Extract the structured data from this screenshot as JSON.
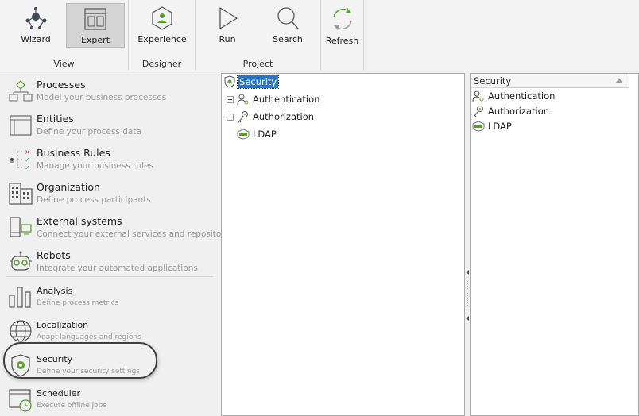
{
  "ribbon": {
    "groups": [
      {
        "label": "View",
        "buttons": [
          {
            "label": "Wizard",
            "icon": "wizard-icon"
          },
          {
            "label": "Expert",
            "icon": "expert-icon",
            "active": true
          }
        ]
      },
      {
        "label": "Designer",
        "buttons": [
          {
            "label": "Experience",
            "icon": "experience-icon"
          }
        ]
      },
      {
        "label": "Project",
        "buttons": [
          {
            "label": "Run",
            "icon": "run-icon"
          },
          {
            "label": "Search",
            "icon": "search-icon"
          }
        ]
      },
      {
        "label": "",
        "buttons": [
          {
            "label": "Refresh",
            "icon": "refresh-icon"
          }
        ]
      }
    ]
  },
  "sidebar": {
    "items": [
      {
        "title": "Processes",
        "subtitle": "Model your business processes",
        "icon": "processes-icon"
      },
      {
        "title": "Entities",
        "subtitle": "Define your process data",
        "icon": "entities-icon"
      },
      {
        "title": "Business Rules",
        "subtitle": "Manage your business rules",
        "icon": "business-rules-icon"
      },
      {
        "title": "Organization",
        "subtitle": "Define process participants",
        "icon": "organization-icon"
      },
      {
        "title": "External systems",
        "subtitle": "Connect your external services and repositories",
        "icon": "external-systems-icon"
      },
      {
        "title": "Robots",
        "subtitle": "Integrate your automated applications",
        "icon": "robots-icon"
      },
      {
        "title": "Analysis",
        "subtitle": "Define process metrics",
        "icon": "analysis-icon"
      },
      {
        "title": "Localization",
        "subtitle": "Adapt languages and regions",
        "icon": "localization-icon"
      },
      {
        "title": "Security",
        "subtitle": "Define your security settings",
        "icon": "security-shield-icon"
      },
      {
        "title": "Scheduler",
        "subtitle": "Execute offline jobs",
        "icon": "scheduler-icon"
      }
    ]
  },
  "tree": {
    "root": "Security",
    "children": [
      {
        "label": "Authentication",
        "expandable": true
      },
      {
        "label": "Authorization",
        "expandable": true
      },
      {
        "label": "LDAP",
        "expandable": false
      }
    ]
  },
  "list": {
    "header": "Security",
    "rows": [
      "Authentication",
      "Authorization",
      "LDAP"
    ]
  },
  "colors": {
    "accent_green": "#5aa02c",
    "selection_blue": "#2a76c6"
  }
}
